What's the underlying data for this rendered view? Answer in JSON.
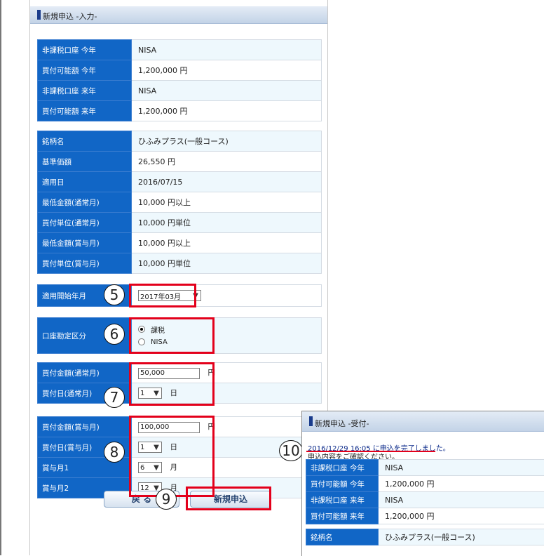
{
  "main": {
    "header_title": "新規申込 -入力-",
    "account_rows": [
      {
        "label": "非課税口座 今年",
        "value": "NISA"
      },
      {
        "label": "買付可能額 今年",
        "value": "1,200,000 円"
      },
      {
        "label": "非課税口座 来年",
        "value": "NISA"
      },
      {
        "label": "買付可能額 来年",
        "value": "1,200,000 円"
      }
    ],
    "fund_rows": [
      {
        "label": "銘柄名",
        "value": "ひふみプラス(一般コース)"
      },
      {
        "label": "基準価額",
        "value": "26,550 円"
      },
      {
        "label": "適用日",
        "value": "2016/07/15"
      },
      {
        "label": "最低金額(通常月)",
        "value": "10,000 円以上"
      },
      {
        "label": "買付単位(通常月)",
        "value": "10,000 円単位"
      },
      {
        "label": "最低金額(賞与月)",
        "value": "10,000 円以上"
      },
      {
        "label": "買付単位(賞与月)",
        "value": "10,000 円単位"
      }
    ],
    "start_month": {
      "label": "適用開始年月",
      "value": "2017年03月"
    },
    "account_type": {
      "label": "口座勘定区分",
      "options": [
        "課税",
        "NISA"
      ],
      "selected": "課税"
    },
    "regular": {
      "amount_label": "買付金額(通常月)",
      "amount_value": "50,000",
      "amount_unit": "円",
      "day_label": "買付日(通常月)",
      "day_value": "1",
      "day_unit": "日"
    },
    "bonus": {
      "amount_label": "買付金額(賞与月)",
      "amount_value": "100,000",
      "amount_unit": "円",
      "day_label": "買付日(賞与月)",
      "day_value": "1",
      "day_unit": "日",
      "month1_label": "賞与月1",
      "month1_value": "6",
      "month1_unit": "月",
      "month2_label": "賞与月2",
      "month2_value": "12",
      "month2_unit": "月"
    },
    "back_button": "戻 る",
    "submit_button": "新規申込"
  },
  "callouts": [
    "5",
    "6",
    "7",
    "8",
    "9",
    "10"
  ],
  "receipt": {
    "header_title": "新規申込 -受付-",
    "message_line1": "2016/12/29 16:05 に申込を完了しました。",
    "message_line2": "申込内容をご確認ください。",
    "rows": [
      {
        "label": "非課税口座 今年",
        "value": "NISA"
      },
      {
        "label": "買付可能額 今年",
        "value": "1,200,000 円"
      },
      {
        "label": "非課税口座 来年",
        "value": "NISA"
      },
      {
        "label": "買付可能額 来年",
        "value": "1,200,000 円"
      }
    ],
    "fund_label": "銘柄名",
    "fund_value": "ひふみプラス(一般コース)"
  },
  "colors": {
    "label_bg": "#1166c6",
    "highlight": "#e3001b",
    "row_alt": "#eef8fd"
  }
}
